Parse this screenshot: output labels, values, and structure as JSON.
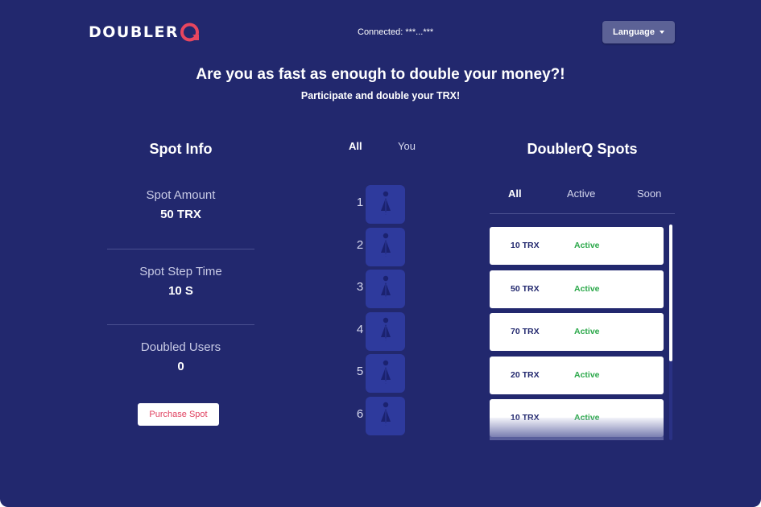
{
  "header": {
    "logo_text": "DOUBLER",
    "logo_q_icon": "q-logo-icon",
    "connected": "Connected: ***...***",
    "language_label": "Language"
  },
  "hero": {
    "headline": "Are you as fast as enough to double your money?!",
    "subline": "Participate and double your TRX!"
  },
  "spot_info": {
    "title": "Spot Info",
    "amount_label": "Spot Amount",
    "amount_value": "50 TRX",
    "step_label": "Spot Step Time",
    "step_value": "10 S",
    "doubled_label": "Doubled Users",
    "doubled_value": "0",
    "purchase_label": "Purchase Spot"
  },
  "queue": {
    "tabs": [
      "All",
      "You"
    ],
    "spots": [
      "1",
      "2",
      "3",
      "4",
      "5",
      "6"
    ],
    "spot_icon": "person-icon"
  },
  "spots_panel": {
    "title": "DoublerQ Spots",
    "tabs": [
      "All",
      "Active",
      "Soon"
    ],
    "items": [
      {
        "amount": "10 TRX",
        "status": "Active"
      },
      {
        "amount": "50 TRX",
        "status": "Active"
      },
      {
        "amount": "70 TRX",
        "status": "Active"
      },
      {
        "amount": "20 TRX",
        "status": "Active"
      },
      {
        "amount": "10 TRX",
        "status": "Active"
      }
    ]
  },
  "colors": {
    "background": "#22286e",
    "accent": "#e8465f",
    "spot_box": "#2e3a9d",
    "status_active": "#2ba84a"
  }
}
